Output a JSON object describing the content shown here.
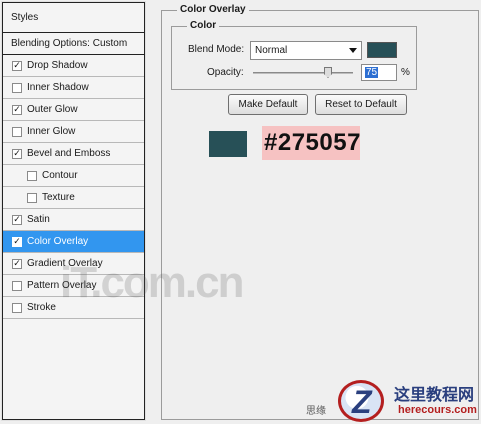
{
  "styles_panel": {
    "header": "Styles",
    "blending_options": "Blending Options: Custom",
    "items": [
      {
        "label": "Drop Shadow",
        "checked": true,
        "sub": false,
        "selected": false
      },
      {
        "label": "Inner Shadow",
        "checked": false,
        "sub": false,
        "selected": false
      },
      {
        "label": "Outer Glow",
        "checked": true,
        "sub": false,
        "selected": false
      },
      {
        "label": "Inner Glow",
        "checked": false,
        "sub": false,
        "selected": false
      },
      {
        "label": "Bevel and Emboss",
        "checked": true,
        "sub": false,
        "selected": false
      },
      {
        "label": "Contour",
        "checked": false,
        "sub": true,
        "selected": false
      },
      {
        "label": "Texture",
        "checked": false,
        "sub": true,
        "selected": false
      },
      {
        "label": "Satin",
        "checked": true,
        "sub": false,
        "selected": false
      },
      {
        "label": "Color Overlay",
        "checked": true,
        "sub": false,
        "selected": true
      },
      {
        "label": "Gradient Overlay",
        "checked": true,
        "sub": false,
        "selected": false
      },
      {
        "label": "Pattern Overlay",
        "checked": false,
        "sub": false,
        "selected": false
      },
      {
        "label": "Stroke",
        "checked": false,
        "sub": false,
        "selected": false
      }
    ]
  },
  "color_overlay": {
    "title": "Color Overlay",
    "color_group_title": "Color",
    "blend_mode_label": "Blend Mode:",
    "blend_mode_value": "Normal",
    "overlay_color": "#275057",
    "opacity_label": "Opacity:",
    "opacity_value": "75",
    "opacity_percent": 75,
    "opacity_unit": "%",
    "make_default_label": "Make Default",
    "reset_default_label": "Reset to Default"
  },
  "annotation": {
    "hex_text": "#275057",
    "swatch_color": "#275057"
  },
  "watermarks": {
    "itcom_text": "iT.com.cn",
    "side_text": "思缘",
    "logo_letter": "Z",
    "site_cn": "这里教程网",
    "site_url": "herecours.com"
  },
  "colors": {
    "selection_blue": "#3296ef",
    "hex_highlight": "#f6c2c2"
  }
}
